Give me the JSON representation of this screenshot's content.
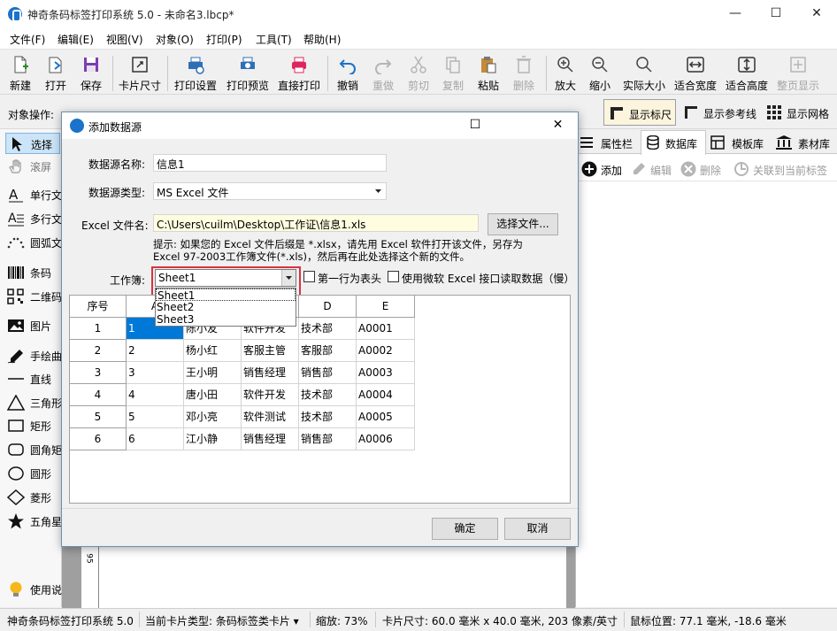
{
  "app": {
    "title": "神奇条码标签打印系统 5.0 - 未命名3.lbcp*",
    "window_controls": {
      "minimize": "—",
      "maximize": "☐",
      "close": "✕"
    }
  },
  "menus": [
    "文件(F)",
    "编辑(E)",
    "视图(V)",
    "对象(O)",
    "打印(P)",
    "工具(T)",
    "帮助(H)"
  ],
  "toolbar": [
    {
      "label": "新建",
      "icon": "new-file-icon",
      "enabled": true
    },
    {
      "label": "打开",
      "icon": "open-icon",
      "enabled": true
    },
    {
      "label": "保存",
      "icon": "save-icon",
      "enabled": true
    },
    {
      "label": "卡片尺寸",
      "icon": "card-size-icon",
      "enabled": true
    },
    {
      "label": "打印设置",
      "icon": "print-settings-icon",
      "enabled": true
    },
    {
      "label": "打印预览",
      "icon": "print-preview-icon",
      "enabled": true
    },
    {
      "label": "直接打印",
      "icon": "printer-icon",
      "enabled": true
    },
    {
      "label": "撤销",
      "icon": "undo-icon",
      "enabled": true
    },
    {
      "label": "重做",
      "icon": "redo-icon",
      "enabled": false
    },
    {
      "label": "剪切",
      "icon": "cut-icon",
      "enabled": false
    },
    {
      "label": "复制",
      "icon": "copy-icon",
      "enabled": false
    },
    {
      "label": "粘贴",
      "icon": "paste-icon",
      "enabled": true
    },
    {
      "label": "删除",
      "icon": "delete-icon",
      "enabled": false
    },
    {
      "label": "放大",
      "icon": "zoom-in-icon",
      "enabled": true
    },
    {
      "label": "缩小",
      "icon": "zoom-out-icon",
      "enabled": true
    },
    {
      "label": "实际大小",
      "icon": "actual-size-icon",
      "enabled": true
    },
    {
      "label": "适合宽度",
      "icon": "fit-width-icon",
      "enabled": true
    },
    {
      "label": "适合高度",
      "icon": "fit-height-icon",
      "enabled": true
    },
    {
      "label": "整页显示",
      "icon": "full-page-icon",
      "enabled": false
    }
  ],
  "subtoolbar": {
    "object_ops_label": "对象操作:",
    "show_ruler": "显示标尺",
    "show_guides": "显示参考线",
    "show_grid": "显示网格"
  },
  "left_tools": [
    "选择",
    "滚屏",
    "单行文",
    "多行文",
    "圆弧文",
    "条码",
    "二维码",
    "图片",
    "手绘曲",
    "直线",
    "三角形",
    "矩形",
    "圆角矩",
    "圆形",
    "菱形",
    "五角星",
    "使用说明"
  ],
  "right_panel": {
    "tabs": [
      "属性栏",
      "数据库",
      "模板库",
      "素材库"
    ],
    "actions": [
      "添加",
      "编辑",
      "删除",
      "关联到当前标签"
    ]
  },
  "dialog": {
    "title": "添加数据源",
    "name_label": "数据源名称:",
    "name_value": "信息1",
    "type_label": "数据源类型:",
    "type_value": "MS Excel 文件",
    "file_label": "Excel 文件名:",
    "file_value": "C:\\Users\\cuilm\\Desktop\\工作证\\信息1.xls",
    "choose_file": "选择文件...",
    "hint_line1": "提示: 如果您的 Excel 文件后缀是 *.xlsx，请先用 Excel 软件打开该文件，另存为",
    "hint_line2": "Excel 97-2003工作簿文件(*.xls)，然后再在此处选择这个新的文件。",
    "sheet_label": "工作簿:",
    "sheet_value": "Sheet1",
    "sheet_options": [
      "Sheet1",
      "Sheet2",
      "Sheet3"
    ],
    "first_row_header": "第一行为表头",
    "use_ms_interface": "使用微软 Excel 接口读取数据（慢）",
    "ok": "确定",
    "cancel": "取消",
    "grid": {
      "row_header_title": "序号",
      "columns": [
        "A",
        "B",
        "C",
        "D",
        "E"
      ],
      "rows": [
        [
          "1",
          "1",
          "陈小友",
          "软件开发",
          "技术部",
          "A0001"
        ],
        [
          "2",
          "2",
          "杨小红",
          "客服主管",
          "客服部",
          "A0002"
        ],
        [
          "3",
          "3",
          "王小明",
          "销售经理",
          "销售部",
          "A0003"
        ],
        [
          "4",
          "4",
          "唐小田",
          "软件开发",
          "技术部",
          "A0004"
        ],
        [
          "5",
          "5",
          "邓小亮",
          "软件测试",
          "技术部",
          "A0005"
        ],
        [
          "6",
          "6",
          "江小静",
          "销售经理",
          "销售部",
          "A0006"
        ]
      ]
    }
  },
  "statusbar": {
    "app": "神奇条码标签打印系统 5.0",
    "card_type": "当前卡片类型: 条码标签类卡片 ▾",
    "zoom": "缩放: 73%",
    "card_size": "卡片尺寸: 60.0 毫米 x 40.0 毫米, 203 像素/英寸",
    "mouse_pos": "鼠标位置: 77.1 毫米, -18.6 毫米"
  },
  "ruler_mark": "95",
  "colors": {
    "accent": "#1a73c9",
    "selection": "#0078d7",
    "highlight_border": "#d9333f"
  }
}
